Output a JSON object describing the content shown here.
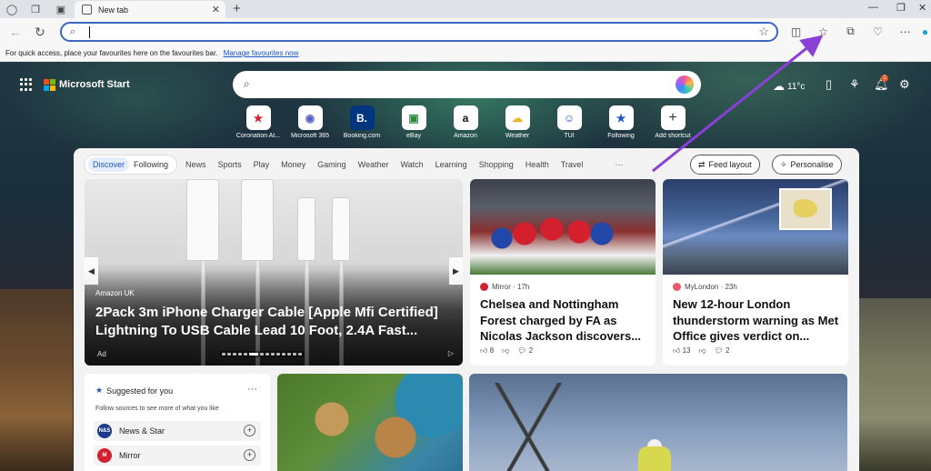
{
  "browser": {
    "tab_title": "New tab",
    "favourites_bar_message": "For quick access, place your favourites here on the favourites bar.",
    "favourites_bar_link": "Manage favourites now",
    "address_value": ""
  },
  "header": {
    "brand": "Microsoft Start",
    "temperature": "11°c",
    "notification_count": "1"
  },
  "shortcuts": [
    {
      "label": "Coronation At...",
      "glyph": "★",
      "color": "#d4202e"
    },
    {
      "label": "Microsoft 365",
      "glyph": "◉",
      "color": "#5b5fc7"
    },
    {
      "label": "Booking.com",
      "glyph": "B.",
      "color": "#ffffff",
      "bg": "#003580"
    },
    {
      "label": "eBay",
      "glyph": "▣",
      "color": "#2b8a3e"
    },
    {
      "label": "Amazon",
      "glyph": "a",
      "color": "#111111"
    },
    {
      "label": "Weather",
      "glyph": "☁",
      "color": "#f0b429"
    },
    {
      "label": "TUI",
      "glyph": "☺",
      "color": "#1a56c4"
    },
    {
      "label": "Following",
      "glyph": "★",
      "color": "#1a56c4"
    },
    {
      "label": "Add shortcut",
      "glyph": "+",
      "color": "#333333"
    }
  ],
  "feed": {
    "tab_discover": "Discover",
    "tab_following": "Following",
    "categories": [
      "News",
      "Sports",
      "Play",
      "Money",
      "Gaming",
      "Weather",
      "Watch",
      "Learning",
      "Shopping",
      "Health",
      "Travel"
    ],
    "more": "···",
    "feed_layout": "Feed layout",
    "personalise": "Personalise"
  },
  "hero": {
    "source": "Amazon UK",
    "title": "2Pack 3m iPhone Charger Cable [Apple Mfi Certified] Lightning To USB Cable Lead 10 Foot, 2.4A Fast...",
    "ad": "Ad"
  },
  "cards": [
    {
      "source": "Mirror · 17h",
      "title": "Chelsea and Nottingham Forest charged by FA as Nicolas Jackson discovers...",
      "likes": "8",
      "comments": "2"
    },
    {
      "source": "MyLondon · 23h",
      "title": "New 12-hour London thunderstorm warning as Met Office gives verdict on...",
      "likes": "13",
      "comments": "2"
    }
  ],
  "suggested": {
    "title": "Suggested for you",
    "subtitle": "Follow sources to see more of what you like",
    "more": "···",
    "sources": [
      {
        "name": "News & Star",
        "logo": "N&S",
        "color": "#1a3a8a"
      },
      {
        "name": "Mirror",
        "logo": "Mirror",
        "color": "#d4202e"
      }
    ]
  },
  "colors": {
    "accent": "#3a66c4",
    "annotation_arrow": "#8a3fd6"
  }
}
